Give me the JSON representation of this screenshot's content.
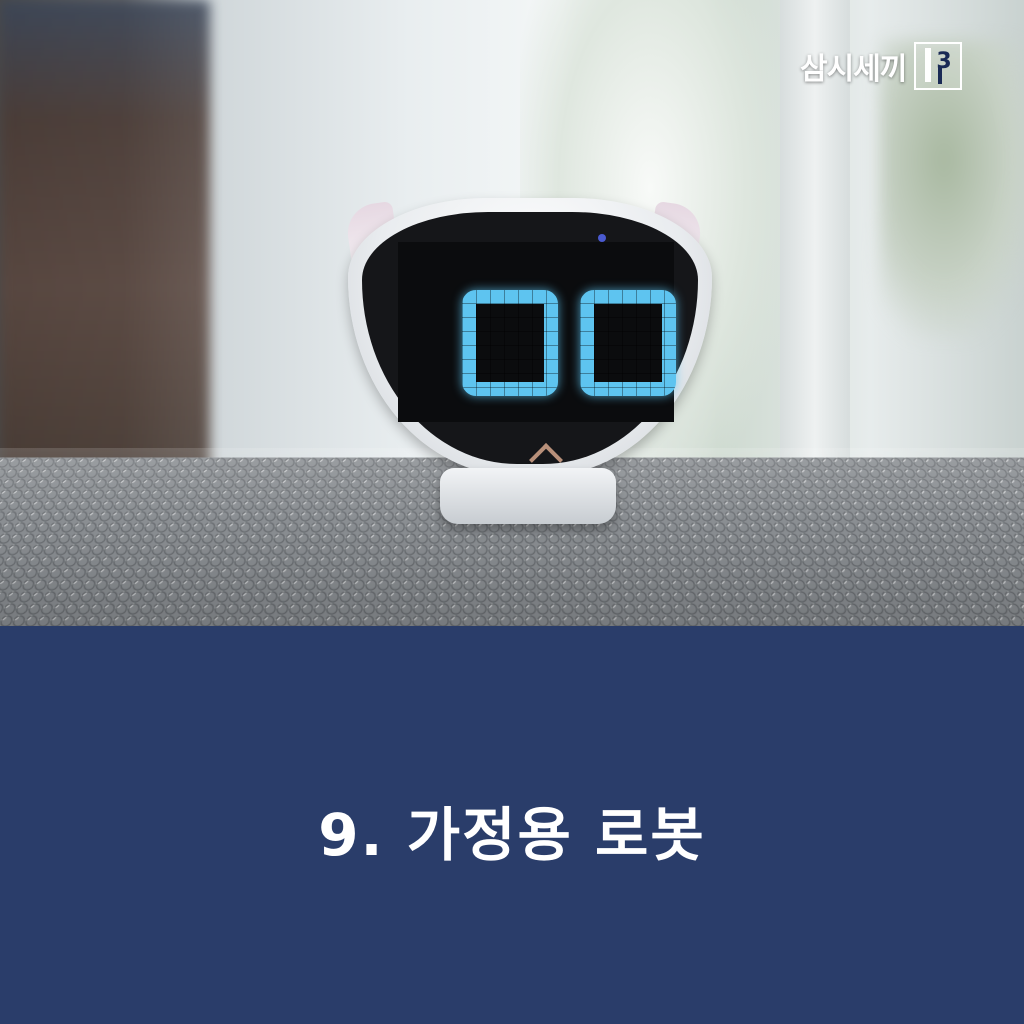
{
  "photo": {
    "logo": {
      "text": "삼시세끼",
      "season_mark": "3"
    }
  },
  "caption": {
    "title": "9. 가정용 로봇",
    "background_color": "#2a3d6a",
    "text_color": "#ffffff"
  },
  "robot": {
    "eye_color": "#5ec4f0",
    "body_color": "#e9ecef"
  }
}
